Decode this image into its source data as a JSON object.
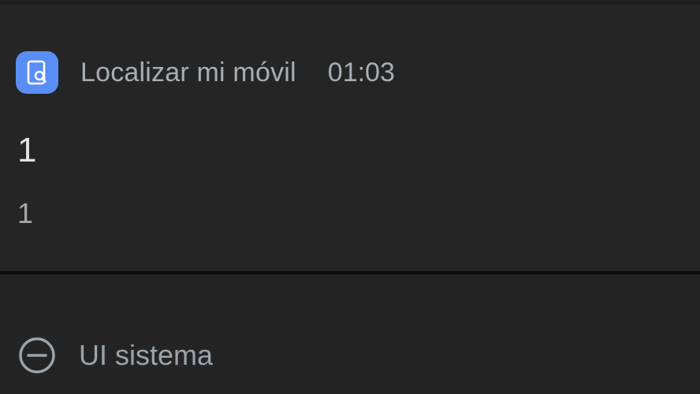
{
  "notification": {
    "app_icon": "find-my-mobile-icon",
    "app_name": "Localizar mi móvil",
    "time": "01:03",
    "title": "1",
    "body": "1"
  },
  "system": {
    "icon": "minus-circle-icon",
    "label": "UI sistema"
  },
  "colors": {
    "background": "#242424",
    "app_icon_bg": "#5a8ef7",
    "muted_text": "#a6aeb6",
    "title_text": "#e2e2e2",
    "divider": "#0d0d0d"
  }
}
